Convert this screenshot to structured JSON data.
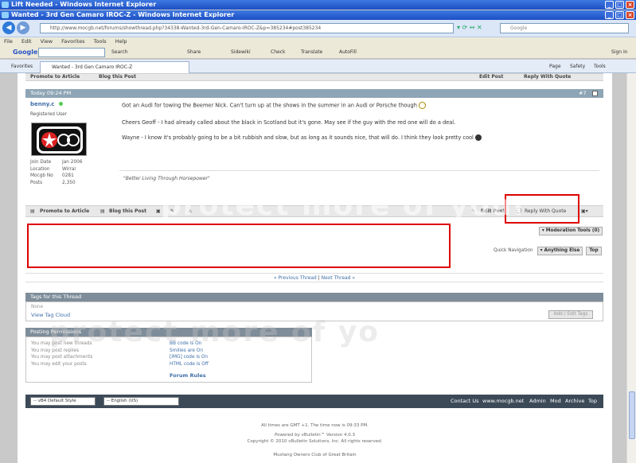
{
  "windows": {
    "back_title": "Lift Needed - Windows Internet Explorer",
    "front_title": "Wanted - 3rd Gen Camaro IROC-Z - Windows Internet Explorer"
  },
  "address": {
    "url": "http://www.mocgb.net/forums/showthread.php?34338-Wanted-3rd-Gen-Camaro-IROC-Z&p=385234#post385234",
    "search_placeholder": "Google"
  },
  "menu": [
    "File",
    "Edit",
    "View",
    "Favorites",
    "Tools",
    "Help"
  ],
  "google_toolbar": {
    "logo": "Google",
    "items": [
      "Search",
      "Share",
      "Sidewiki",
      "Check",
      "Translate",
      "AutoFill"
    ],
    "signin": "Sign In"
  },
  "favorites": {
    "label": "Favorites",
    "tab": "Wanted - 3rd Gen Camaro IROC-Z",
    "tools": [
      "Page",
      "Safety",
      "Tools"
    ]
  },
  "top_toolbar": {
    "promote": "Promote to Article",
    "blog": "Blog this Post",
    "edit": "Edit Post",
    "reply": "Reply With Quote"
  },
  "post": {
    "date": "Today 09:24 PM",
    "number": "#7",
    "username": "benny.c",
    "rank": "Registered User",
    "meta": [
      {
        "k": "Join Date",
        "v": "Jan 2006"
      },
      {
        "k": "Location",
        "v": "Wirral"
      },
      {
        "k": "Mocgb No",
        "v": "0281"
      },
      {
        "k": "Posts",
        "v": "2,350"
      }
    ],
    "paragraphs": [
      "Got an Audi for towing the Beemer Nick. Can't turn up at the shows in the summer in an Audi or Porsche though",
      "Cheers Geoff - I had already called about the black in Scotland but it's gone. May see if the guy with the red one will do a deal.",
      "Wayne - I know it's probably going to be a bit rubbish and slow, but as long as it sounds nice, that will do. I think they look pretty cool"
    ],
    "signature": "\"Better Living Through Horsepower\""
  },
  "post_toolbar": {
    "promote": "Promote to Article",
    "blog": "Blog this Post",
    "edit": "Edit Post",
    "reply": "Reply With Quote"
  },
  "controls": {
    "moderation": "Moderation Tools (0)",
    "quick_nav": "Quick Navigation",
    "anything_else": "Anything Else",
    "top": "Top"
  },
  "thread_nav": {
    "prev": "« Previous Thread",
    "sep": "|",
    "next": "Next Thread »"
  },
  "tags": {
    "header": "Tags for this Thread",
    "none": "None",
    "cloud": "View Tag Cloud",
    "add": "Add / Edit Tags"
  },
  "permissions": {
    "header": "Posting Permissions",
    "left": [
      "You may post new threads",
      "You may post replies",
      "You may post attachments",
      "You may edit your posts"
    ],
    "right": [
      "BB code is On",
      "Smilies are On",
      "[IMG] code is On",
      "HTML code is Off"
    ],
    "rules": "Forum Rules"
  },
  "footer": {
    "style": "-- vB4 Default Style",
    "language": "-- English (US)",
    "links": [
      "Contact Us",
      "www.mocgb.net",
      "Admin",
      "Mod",
      "Archive",
      "Top"
    ]
  },
  "bottom": {
    "time": "All times are GMT +1. The time now is 09:33 PM.",
    "powered": "Powered by vBulletin™ Version 4.0.3",
    "copyright": "Copyright © 2010 vBulletin Solutions, Inc. All rights reserved.",
    "site": "Mustang Owners Club of Great Britain"
  },
  "watermark": {
    "top": "protect more of your",
    "bottom": "protect more of yo"
  }
}
